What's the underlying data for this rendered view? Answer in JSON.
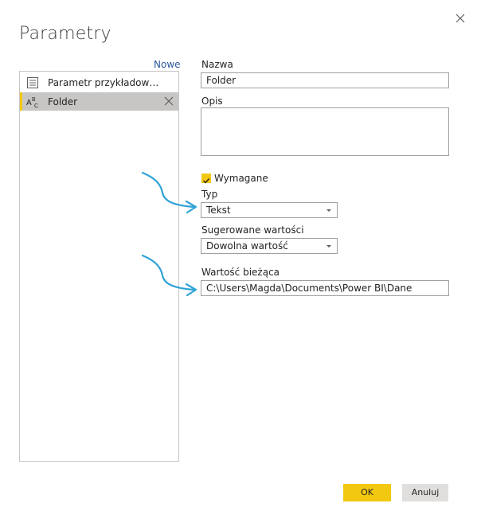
{
  "dialog": {
    "title": "Parametry",
    "new_label": "Nowe",
    "params": [
      {
        "label": "Parametr przykładowego...",
        "icon": "document-icon"
      },
      {
        "label": "Folder",
        "icon": "text-type-icon",
        "type_icon_text": "A B C"
      }
    ]
  },
  "form": {
    "name_label": "Nazwa",
    "name_value": "Folder",
    "desc_label": "Opis",
    "desc_value": "",
    "required_label": "Wymagane",
    "required_checked": true,
    "type_label": "Typ",
    "type_value": "Tekst",
    "suggested_label": "Sugerowane wartości",
    "suggested_value": "Dowolna wartość",
    "current_label": "Wartość bieżąca",
    "current_value": "C:\\Users\\Magda\\Documents\\Power BI\\Dane"
  },
  "buttons": {
    "ok": "OK",
    "cancel": "Anuluj"
  },
  "colors": {
    "accent": "#f2c811",
    "arrow": "#2ea3d6",
    "link": "#2b579a",
    "selection": "#c8c6c4"
  }
}
